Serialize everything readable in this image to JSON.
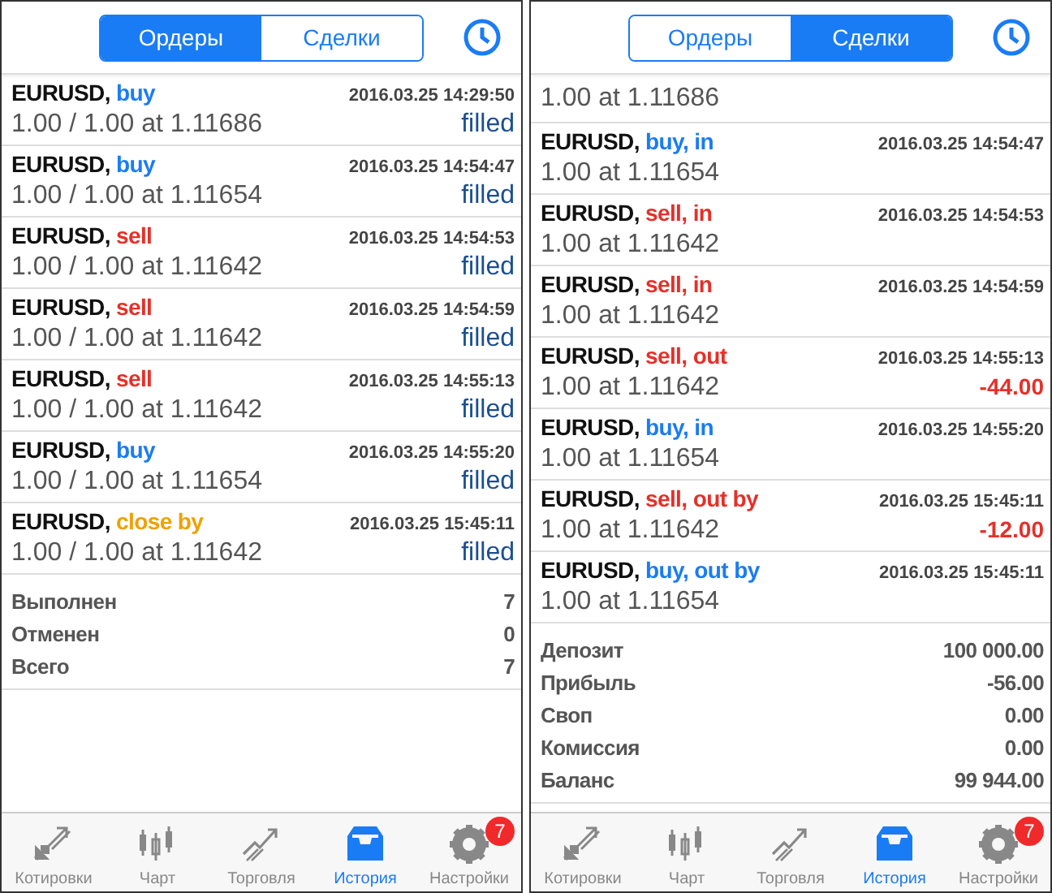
{
  "screens": [
    {
      "segments": [
        {
          "label": "Ордеры",
          "selected": true
        },
        {
          "label": "Сделки",
          "selected": false
        }
      ],
      "rows": [
        {
          "symbol": "EURUSD,",
          "side": "buy",
          "kind": "buy",
          "time": "2016.03.25 14:29:50",
          "volume": "1.00 / 1.00 at 1.11686",
          "status": "filled"
        },
        {
          "symbol": "EURUSD,",
          "side": "buy",
          "kind": "buy",
          "time": "2016.03.25 14:54:47",
          "volume": "1.00 / 1.00 at 1.11654",
          "status": "filled"
        },
        {
          "symbol": "EURUSD,",
          "side": "sell",
          "kind": "sell",
          "time": "2016.03.25 14:54:53",
          "volume": "1.00 / 1.00 at 1.11642",
          "status": "filled"
        },
        {
          "symbol": "EURUSD,",
          "side": "sell",
          "kind": "sell",
          "time": "2016.03.25 14:54:59",
          "volume": "1.00 / 1.00 at 1.11642",
          "status": "filled"
        },
        {
          "symbol": "EURUSD,",
          "side": "sell",
          "kind": "sell",
          "time": "2016.03.25 14:55:13",
          "volume": "1.00 / 1.00 at 1.11642",
          "status": "filled"
        },
        {
          "symbol": "EURUSD,",
          "side": "buy",
          "kind": "buy",
          "time": "2016.03.25 14:55:20",
          "volume": "1.00 / 1.00 at 1.11654",
          "status": "filled"
        },
        {
          "symbol": "EURUSD,",
          "side": "close by",
          "kind": "close",
          "time": "2016.03.25 15:45:11",
          "volume": "1.00 / 1.00 at 1.11642",
          "status": "filled"
        }
      ],
      "summary": [
        {
          "label": "Выполнен",
          "value": "7"
        },
        {
          "label": "Отменен",
          "value": "0"
        },
        {
          "label": "Всего",
          "value": "7"
        }
      ],
      "nav": [
        {
          "label": "Котировки",
          "kind": "quotes",
          "selected": false
        },
        {
          "label": "Чарт",
          "kind": "chart",
          "selected": false
        },
        {
          "label": "Торговля",
          "kind": "trade",
          "selected": false
        },
        {
          "label": "История",
          "kind": "history",
          "selected": true
        },
        {
          "label": "Настройки",
          "kind": "settings",
          "selected": false,
          "badge": "7"
        }
      ]
    },
    {
      "segments": [
        {
          "label": "Ордеры",
          "selected": false
        },
        {
          "label": "Сделки",
          "selected": true
        }
      ],
      "rows": [
        {
          "volume": "1.00 at 1.11686"
        },
        {
          "symbol": "EURUSD,",
          "side": "buy, in",
          "kind": "buy",
          "time": "2016.03.25 14:54:47",
          "volume": "1.00 at 1.11654"
        },
        {
          "symbol": "EURUSD,",
          "side": "sell, in",
          "kind": "sell",
          "time": "2016.03.25 14:54:53",
          "volume": "1.00 at 1.11642"
        },
        {
          "symbol": "EURUSD,",
          "side": "sell, in",
          "kind": "sell",
          "time": "2016.03.25 14:54:59",
          "volume": "1.00 at 1.11642"
        },
        {
          "symbol": "EURUSD,",
          "side": "sell, out",
          "kind": "sell",
          "time": "2016.03.25 14:55:13",
          "volume": "1.00 at 1.11642",
          "profit": "-44.00"
        },
        {
          "symbol": "EURUSD,",
          "side": "buy, in",
          "kind": "buy",
          "time": "2016.03.25 14:55:20",
          "volume": "1.00 at 1.11654"
        },
        {
          "symbol": "EURUSD,",
          "side": "sell, out by",
          "kind": "sell",
          "time": "2016.03.25 15:45:11",
          "volume": "1.00 at 1.11642",
          "profit": "-12.00"
        },
        {
          "symbol": "EURUSD,",
          "side": "buy, out by",
          "kind": "buy",
          "time": "2016.03.25 15:45:11",
          "volume": "1.00 at 1.11654"
        }
      ],
      "summary": [
        {
          "label": "Депозит",
          "value": "100 000.00"
        },
        {
          "label": "Прибыль",
          "value": "-56.00"
        },
        {
          "label": "Своп",
          "value": "0.00"
        },
        {
          "label": "Комиссия",
          "value": "0.00"
        },
        {
          "label": "Баланс",
          "value": "99 944.00"
        }
      ],
      "nav": [
        {
          "label": "Котировки",
          "kind": "quotes",
          "selected": false
        },
        {
          "label": "Чарт",
          "kind": "chart",
          "selected": false
        },
        {
          "label": "Торговля",
          "kind": "trade",
          "selected": false
        },
        {
          "label": "История",
          "kind": "history",
          "selected": true
        },
        {
          "label": "Настройки",
          "kind": "settings",
          "selected": false,
          "badge": "7"
        }
      ]
    }
  ]
}
